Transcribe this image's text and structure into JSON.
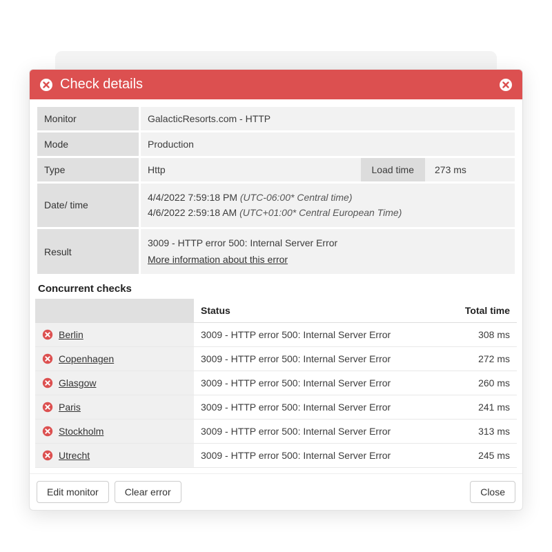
{
  "header": {
    "title": "Check details"
  },
  "details": {
    "monitor_label": "Monitor",
    "monitor_value": "GalacticResorts.com - HTTP",
    "mode_label": "Mode",
    "mode_value": "Production",
    "type_label": "Type",
    "type_value": "Http",
    "loadtime_label": "Load time",
    "loadtime_value": "273 ms",
    "datetime_label": "Date/ time",
    "datetime_line1_main": "4/4/2022 7:59:18 PM ",
    "datetime_line1_tz": "(UTC-06:00* Central time)",
    "datetime_line2_main": "4/6/2022 2:59:18 AM ",
    "datetime_line2_tz": "(UTC+01:00* Central European Time)",
    "result_label": "Result",
    "result_value": "3009 - HTTP error 500: Internal Server Error",
    "result_link": "More information about this error"
  },
  "concurrent": {
    "title": "Concurrent checks",
    "col_status": "Status",
    "col_total": "Total time",
    "rows": [
      {
        "location": "Berlin",
        "status": "3009 - HTTP error 500: Internal Server Error",
        "time": "308 ms"
      },
      {
        "location": "Copenhagen",
        "status": "3009 - HTTP error 500: Internal Server Error",
        "time": "272 ms"
      },
      {
        "location": "Glasgow",
        "status": "3009 - HTTP error 500: Internal Server Error",
        "time": "260 ms"
      },
      {
        "location": "Paris",
        "status": "3009 - HTTP error 500: Internal Server Error",
        "time": "241 ms"
      },
      {
        "location": "Stockholm",
        "status": "3009 - HTTP error 500: Internal Server Error",
        "time": "313 ms"
      },
      {
        "location": "Utrecht",
        "status": "3009 - HTTP error 500: Internal Server Error",
        "time": "245 ms"
      }
    ]
  },
  "footer": {
    "edit": "Edit monitor",
    "clear": "Clear error",
    "close": "Close"
  }
}
